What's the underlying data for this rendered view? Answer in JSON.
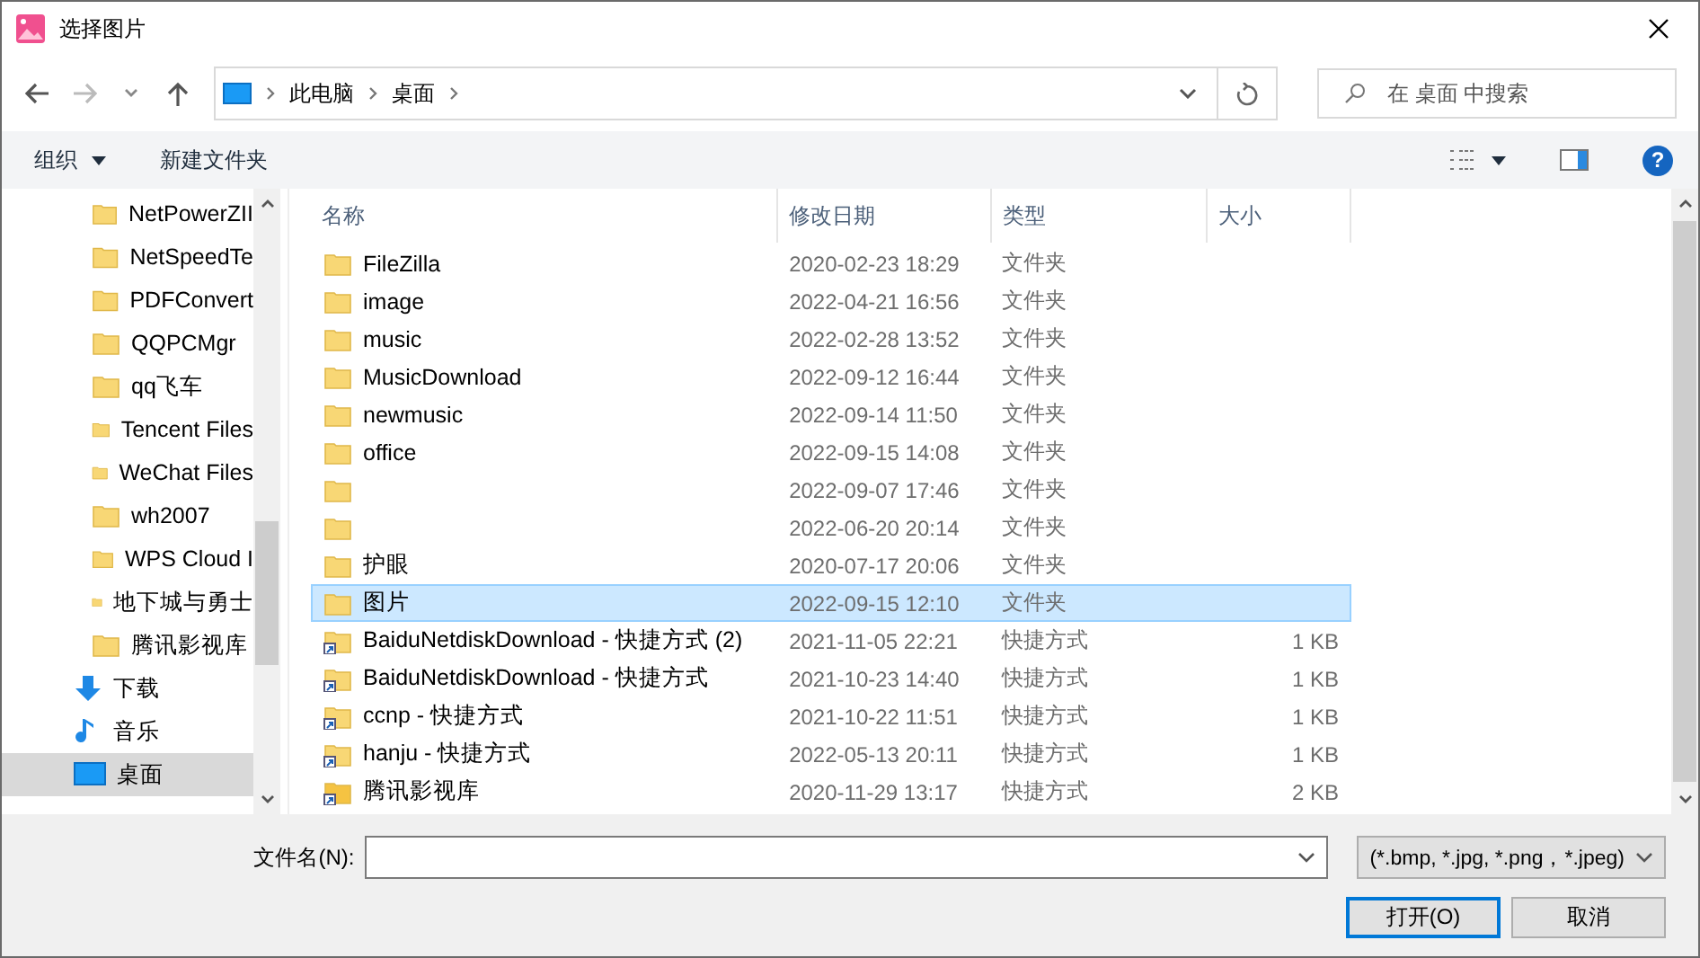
{
  "window": {
    "title": "选择图片"
  },
  "address": {
    "path": [
      {
        "label": "此电脑"
      },
      {
        "label": "桌面"
      }
    ]
  },
  "search": {
    "placeholder": "在 桌面 中搜索"
  },
  "toolbar": {
    "organize": "组织",
    "new_folder": "新建文件夹",
    "help": "?"
  },
  "sidebar": {
    "items": [
      {
        "label": "NetPowerZII",
        "kind": "folder",
        "selected": false
      },
      {
        "label": "NetSpeedTe",
        "kind": "folder",
        "selected": false
      },
      {
        "label": "PDFConvert",
        "kind": "folder",
        "selected": false
      },
      {
        "label": "QQPCMgr",
        "kind": "folder",
        "selected": false
      },
      {
        "label": "qq飞车",
        "kind": "folder",
        "selected": false
      },
      {
        "label": "Tencent Files",
        "kind": "folder",
        "selected": false
      },
      {
        "label": "WeChat Files",
        "kind": "folder",
        "selected": false
      },
      {
        "label": "wh2007",
        "kind": "folder",
        "selected": false
      },
      {
        "label": "WPS Cloud I",
        "kind": "folder",
        "selected": false
      },
      {
        "label": "地下城与勇士",
        "kind": "folder",
        "selected": false
      },
      {
        "label": "腾讯影视库",
        "kind": "folder",
        "selected": false
      },
      {
        "label": "下载",
        "kind": "download",
        "selected": false
      },
      {
        "label": "音乐",
        "kind": "music",
        "selected": false
      },
      {
        "label": "桌面",
        "kind": "desktop",
        "selected": true
      }
    ]
  },
  "table": {
    "columns": [
      "名称",
      "修改日期",
      "类型",
      "大小"
    ],
    "rows": [
      {
        "name": "FileZilla",
        "date": "2020-02-23 18:29",
        "type": "文件夹",
        "kind": "folder",
        "selected": false
      },
      {
        "name": "image",
        "date": "2022-04-21 16:56",
        "type": "文件夹",
        "kind": "folder",
        "selected": false
      },
      {
        "name": "music",
        "date": "2022-02-28 13:52",
        "type": "文件夹",
        "kind": "folder",
        "selected": false
      },
      {
        "name": "MusicDownload",
        "date": "2022-09-12 16:44",
        "type": "文件夹",
        "kind": "folder",
        "selected": false
      },
      {
        "name": "newmusic",
        "date": "2022-09-14 11:50",
        "type": "文件夹",
        "kind": "folder",
        "selected": false
      },
      {
        "name": "office",
        "date": "2022-09-15 14:08",
        "type": "文件夹",
        "kind": "folder",
        "selected": false
      },
      {
        "date": "2022-09-07 17:46",
        "type": "文件夹",
        "kind": "folder",
        "selected": false
      },
      {
        "date": "2022-06-20 20:14",
        "type": "文件夹",
        "kind": "folder",
        "selected": false
      },
      {
        "name": "护眼",
        "date": "2020-07-17 20:06",
        "type": "文件夹",
        "kind": "folder",
        "selected": false
      },
      {
        "name": "图片",
        "date": "2022-09-15 12:10",
        "type": "文件夹",
        "kind": "folder",
        "selected": true
      },
      {
        "name": "BaiduNetdiskDownload - 快捷方式 (2)",
        "date": "2021-11-05 22:21",
        "type": "快捷方式",
        "size": "1 KB",
        "kind": "shortcut",
        "selected": false
      },
      {
        "name": "BaiduNetdiskDownload - 快捷方式",
        "date": "2021-10-23 14:40",
        "type": "快捷方式",
        "size": "1 KB",
        "kind": "shortcut",
        "selected": false
      },
      {
        "name": "ccnp - 快捷方式",
        "date": "2021-10-22 11:51",
        "type": "快捷方式",
        "size": "1 KB",
        "kind": "shortcut",
        "selected": false
      },
      {
        "name": "hanju - 快捷方式",
        "date": "2022-05-13 20:11",
        "type": "快捷方式",
        "size": "1 KB",
        "kind": "shortcut",
        "selected": false
      },
      {
        "name": "腾讯影视库",
        "date": "2020-11-29 13:17",
        "type": "快捷方式",
        "size": "2 KB",
        "kind": "app-shortcut",
        "selected": false
      }
    ]
  },
  "footer": {
    "filename_label": "文件名(N):",
    "filter": "(*.bmp, *.jpg, *.png，*.jpeg)",
    "buttons": [
      {
        "label": "打开(O)",
        "kind": "primary"
      },
      {
        "label": "取消",
        "kind": "normal"
      }
    ]
  }
}
